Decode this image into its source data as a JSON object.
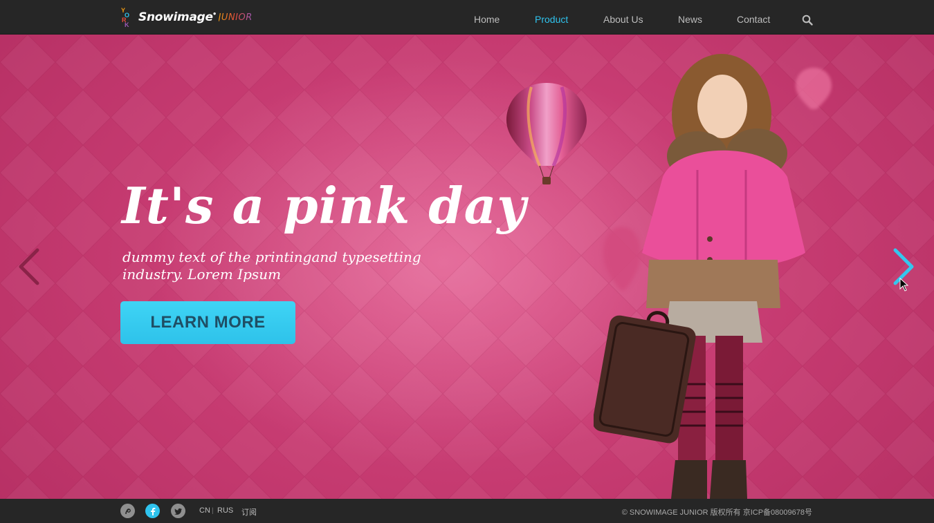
{
  "header": {
    "logo": {
      "brand": "Snowimage",
      "sub": "JUNIOR",
      "mark_letters": [
        "Y",
        "O",
        "R",
        "K"
      ]
    },
    "nav": [
      {
        "label": "Home"
      },
      {
        "label": "Product",
        "active": true
      },
      {
        "label": "About Us"
      },
      {
        "label": "News"
      },
      {
        "label": "Contact"
      }
    ],
    "search_icon": "search-icon"
  },
  "hero": {
    "headline": "It's a pink day",
    "subtext": "dummy text of the printingand typesetting industry. Lorem Ipsum",
    "cta_label": "LEARN MORE",
    "prev_icon": "chevron-left-icon",
    "next_icon": "chevron-right-icon"
  },
  "footer": {
    "social": [
      {
        "icon": "tencent-weibo-icon"
      },
      {
        "icon": "facebook-icon"
      },
      {
        "icon": "twitter-icon"
      }
    ],
    "languages": [
      "CN",
      "RUS"
    ],
    "subscribe": "订阅",
    "copyright": "© SNOWIMAGE JUNIOR 版权所有  京ICP备08009678号"
  },
  "colors": {
    "accent": "#2fc3ee",
    "hero_pink": "#c53a70",
    "bar_bg": "#262626",
    "cta_text": "#1f4e64"
  }
}
